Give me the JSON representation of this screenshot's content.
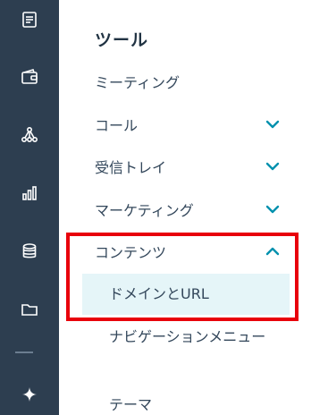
{
  "rail": {
    "icons": [
      "notebook-icon",
      "wallet-icon",
      "sitemap-icon",
      "bar-chart-icon",
      "database-icon",
      "folder-icon",
      "sparkle-icon"
    ]
  },
  "panel": {
    "title": "ツール",
    "items": [
      {
        "label": "ミーティング",
        "has_chevron": false
      },
      {
        "label": "コール",
        "has_chevron": true
      },
      {
        "label": "受信トレイ",
        "has_chevron": true
      },
      {
        "label": "マーケティング",
        "has_chevron": true
      },
      {
        "label": "コンテンツ",
        "has_chevron": true,
        "expanded": true
      }
    ],
    "subitems": [
      {
        "label": "ドメインとURL",
        "active": true
      },
      {
        "label": "ナビゲーションメニュー",
        "active": false
      },
      {
        "label": "テーマ",
        "active": false
      }
    ]
  },
  "colors": {
    "rail_bg": "#2d3e50",
    "accent_teal": "#0091ae",
    "active_bg": "#e5f5f8",
    "highlight_red": "#e8000b"
  }
}
